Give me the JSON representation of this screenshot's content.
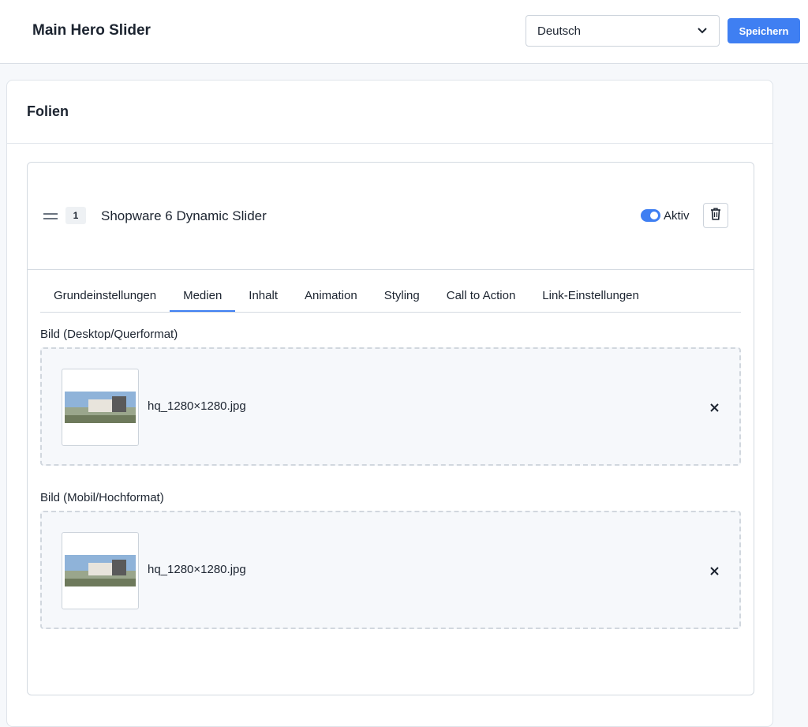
{
  "header": {
    "title": "Main Hero Slider",
    "language": {
      "selected": "Deutsch"
    },
    "save_label": "Speichern"
  },
  "section": {
    "title": "Folien"
  },
  "slide": {
    "number": "1",
    "name": "Shopware 6 Dynamic Slider",
    "active_label": "Aktiv",
    "active": true
  },
  "tabs": [
    {
      "label": "Grundeinstellungen"
    },
    {
      "label": "Medien",
      "active": true
    },
    {
      "label": "Inhalt"
    },
    {
      "label": "Animation"
    },
    {
      "label": "Styling"
    },
    {
      "label": "Call to Action"
    },
    {
      "label": "Link-Einstellungen"
    }
  ],
  "media": {
    "desktop": {
      "label": "Bild (Desktop/Querformat)",
      "filename": "hq_1280×1280.jpg"
    },
    "mobile": {
      "label": "Bild (Mobil/Hochformat)",
      "filename": "hq_1280×1280.jpg"
    }
  },
  "colors": {
    "accent": "#3f7ff2",
    "border": "#d4dae1",
    "text": "#1c2430"
  },
  "icons": [
    "chevron-down-icon",
    "drag-handle-icon",
    "trash-icon",
    "close-icon"
  ]
}
